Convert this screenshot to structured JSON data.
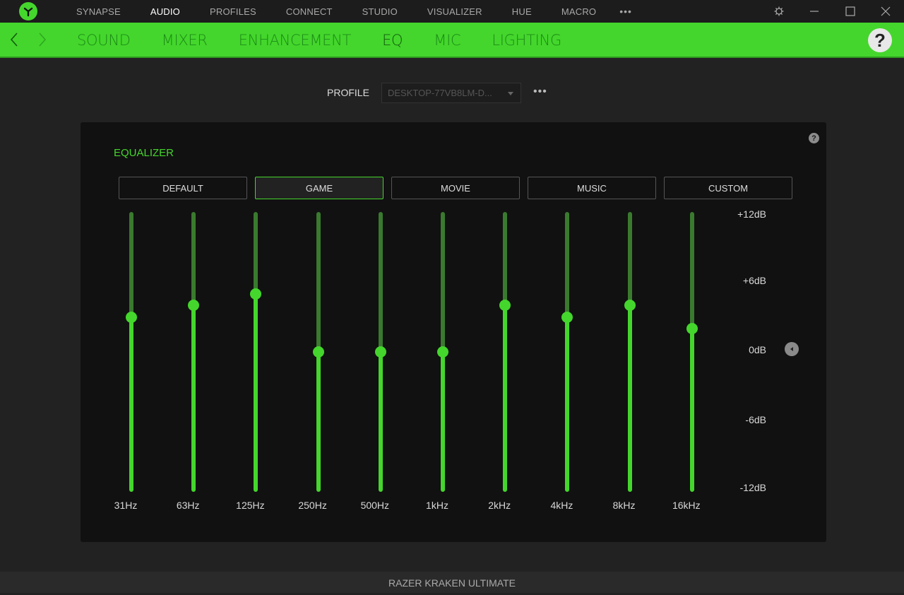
{
  "topnav": {
    "items": [
      {
        "label": "SYNAPSE",
        "active": false
      },
      {
        "label": "AUDIO",
        "active": true
      },
      {
        "label": "PROFILES",
        "active": false
      },
      {
        "label": "CONNECT",
        "active": false
      },
      {
        "label": "STUDIO",
        "active": false
      },
      {
        "label": "VISUALIZER",
        "active": false
      },
      {
        "label": "HUE",
        "active": false
      },
      {
        "label": "MACRO",
        "active": false
      }
    ],
    "more_label": "•••"
  },
  "subnav": {
    "items": [
      {
        "label": "SOUND",
        "active": false
      },
      {
        "label": "MIXER",
        "active": false
      },
      {
        "label": "ENHANCEMENT",
        "active": false
      },
      {
        "label": "EQ",
        "active": true
      },
      {
        "label": "MIC",
        "active": false
      },
      {
        "label": "LIGHTING",
        "active": false
      }
    ],
    "help_label": "?"
  },
  "profile": {
    "label": "PROFILE",
    "selected": "DESKTOP-77VB8LM-D...",
    "more_label": "•••"
  },
  "equalizer": {
    "title": "EQUALIZER",
    "help_label": "?",
    "presets": [
      {
        "label": "DEFAULT",
        "active": false
      },
      {
        "label": "GAME",
        "active": true
      },
      {
        "label": "MOVIE",
        "active": false
      },
      {
        "label": "MUSIC",
        "active": false
      },
      {
        "label": "CUSTOM",
        "active": false
      }
    ],
    "range_db": [
      -12,
      12
    ],
    "db_labels": [
      "+12dB",
      "+6dB",
      "0dB",
      "-6dB",
      "-12dB"
    ],
    "bands": [
      {
        "freq": "31Hz",
        "gain_db": 3
      },
      {
        "freq": "63Hz",
        "gain_db": 4
      },
      {
        "freq": "125Hz",
        "gain_db": 5
      },
      {
        "freq": "250Hz",
        "gain_db": 0
      },
      {
        "freq": "500Hz",
        "gain_db": 0
      },
      {
        "freq": "1kHz",
        "gain_db": 0
      },
      {
        "freq": "2kHz",
        "gain_db": 4
      },
      {
        "freq": "4kHz",
        "gain_db": 3
      },
      {
        "freq": "8kHz",
        "gain_db": 4
      },
      {
        "freq": "16kHz",
        "gain_db": 2
      }
    ]
  },
  "footer": {
    "device_name": "RAZER KRAKEN ULTIMATE"
  },
  "colors": {
    "accent": "#44d62c",
    "track_inactive": "#3a7a2e",
    "background": "#222222",
    "panel": "#111111"
  }
}
